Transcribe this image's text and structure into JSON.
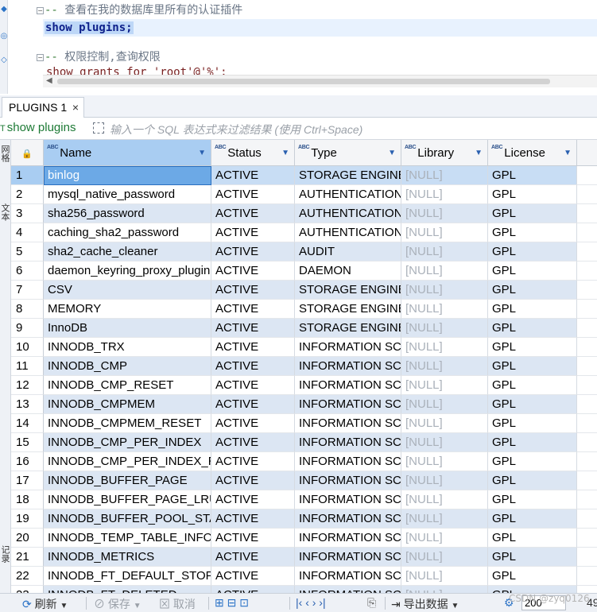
{
  "editor": {
    "comment1": "查看在我的数据库里所有的认证插件",
    "statement": "show plugins;",
    "comment2": "权限控制,查询权限",
    "partial_line": "show grants for 'root'@'%';"
  },
  "tab": {
    "label": "PLUGINS 1",
    "close": "×"
  },
  "filter": {
    "sql_label": "show plugins",
    "placeholder": "输入一个 SQL 表达式来过滤结果 (使用 Ctrl+Space)"
  },
  "left_strip": {
    "label_top": "网格",
    "label_mid": "文本",
    "label_bottom": "记录"
  },
  "grid": {
    "columns": [
      {
        "key": "name",
        "label": "Name"
      },
      {
        "key": "status",
        "label": "Status"
      },
      {
        "key": "type",
        "label": "Type"
      },
      {
        "key": "library",
        "label": "Library"
      },
      {
        "key": "license",
        "label": "License"
      }
    ],
    "type_badge": "ABC",
    "lock_icon": "🔒",
    "sort_icon": "▼",
    "rows": [
      {
        "n": "1",
        "name": "binlog",
        "status": "ACTIVE",
        "type": "STORAGE ENGINE",
        "library": "[NULL]",
        "license": "GPL"
      },
      {
        "n": "2",
        "name": "mysql_native_password",
        "status": "ACTIVE",
        "type": "AUTHENTICATION",
        "library": "[NULL]",
        "license": "GPL"
      },
      {
        "n": "3",
        "name": "sha256_password",
        "status": "ACTIVE",
        "type": "AUTHENTICATION",
        "library": "[NULL]",
        "license": "GPL"
      },
      {
        "n": "4",
        "name": "caching_sha2_password",
        "status": "ACTIVE",
        "type": "AUTHENTICATION",
        "library": "[NULL]",
        "license": "GPL"
      },
      {
        "n": "5",
        "name": "sha2_cache_cleaner",
        "status": "ACTIVE",
        "type": "AUDIT",
        "library": "[NULL]",
        "license": "GPL"
      },
      {
        "n": "6",
        "name": "daemon_keyring_proxy_plugin",
        "status": "ACTIVE",
        "type": "DAEMON",
        "library": "[NULL]",
        "license": "GPL"
      },
      {
        "n": "7",
        "name": "CSV",
        "status": "ACTIVE",
        "type": "STORAGE ENGINE",
        "library": "[NULL]",
        "license": "GPL"
      },
      {
        "n": "8",
        "name": "MEMORY",
        "status": "ACTIVE",
        "type": "STORAGE ENGINE",
        "library": "[NULL]",
        "license": "GPL"
      },
      {
        "n": "9",
        "name": "InnoDB",
        "status": "ACTIVE",
        "type": "STORAGE ENGINE",
        "library": "[NULL]",
        "license": "GPL"
      },
      {
        "n": "10",
        "name": "INNODB_TRX",
        "status": "ACTIVE",
        "type": "INFORMATION SCHEMA",
        "library": "[NULL]",
        "license": "GPL"
      },
      {
        "n": "11",
        "name": "INNODB_CMP",
        "status": "ACTIVE",
        "type": "INFORMATION SCHEMA",
        "library": "[NULL]",
        "license": "GPL"
      },
      {
        "n": "12",
        "name": "INNODB_CMP_RESET",
        "status": "ACTIVE",
        "type": "INFORMATION SCHEMA",
        "library": "[NULL]",
        "license": "GPL"
      },
      {
        "n": "13",
        "name": "INNODB_CMPMEM",
        "status": "ACTIVE",
        "type": "INFORMATION SCHEMA",
        "library": "[NULL]",
        "license": "GPL"
      },
      {
        "n": "14",
        "name": "INNODB_CMPMEM_RESET",
        "status": "ACTIVE",
        "type": "INFORMATION SCHEMA",
        "library": "[NULL]",
        "license": "GPL"
      },
      {
        "n": "15",
        "name": "INNODB_CMP_PER_INDEX",
        "status": "ACTIVE",
        "type": "INFORMATION SCHEMA",
        "library": "[NULL]",
        "license": "GPL"
      },
      {
        "n": "16",
        "name": "INNODB_CMP_PER_INDEX_RESET",
        "status": "ACTIVE",
        "type": "INFORMATION SCHEMA",
        "library": "[NULL]",
        "license": "GPL"
      },
      {
        "n": "17",
        "name": "INNODB_BUFFER_PAGE",
        "status": "ACTIVE",
        "type": "INFORMATION SCHEMA",
        "library": "[NULL]",
        "license": "GPL"
      },
      {
        "n": "18",
        "name": "INNODB_BUFFER_PAGE_LRU",
        "status": "ACTIVE",
        "type": "INFORMATION SCHEMA",
        "library": "[NULL]",
        "license": "GPL"
      },
      {
        "n": "19",
        "name": "INNODB_BUFFER_POOL_STATS",
        "status": "ACTIVE",
        "type": "INFORMATION SCHEMA",
        "library": "[NULL]",
        "license": "GPL"
      },
      {
        "n": "20",
        "name": "INNODB_TEMP_TABLE_INFO",
        "status": "ACTIVE",
        "type": "INFORMATION SCHEMA",
        "library": "[NULL]",
        "license": "GPL"
      },
      {
        "n": "21",
        "name": "INNODB_METRICS",
        "status": "ACTIVE",
        "type": "INFORMATION SCHEMA",
        "library": "[NULL]",
        "license": "GPL"
      },
      {
        "n": "22",
        "name": "INNODB_FT_DEFAULT_STOPWORD",
        "status": "ACTIVE",
        "type": "INFORMATION SCHEMA",
        "library": "[NULL]",
        "license": "GPL"
      },
      {
        "n": "23",
        "name": "INNODB_FT_DELETED",
        "status": "ACTIVE",
        "type": "INFORMATION SCHEMA",
        "library": "[NULL]",
        "license": "GPL"
      }
    ]
  },
  "statusbar": {
    "refresh": "刷新",
    "save": "保存",
    "cancel": "取消",
    "export": "导出数据",
    "fetch_size": "200",
    "row_count": "49",
    "watermark": "CSDN @zyq0126"
  }
}
